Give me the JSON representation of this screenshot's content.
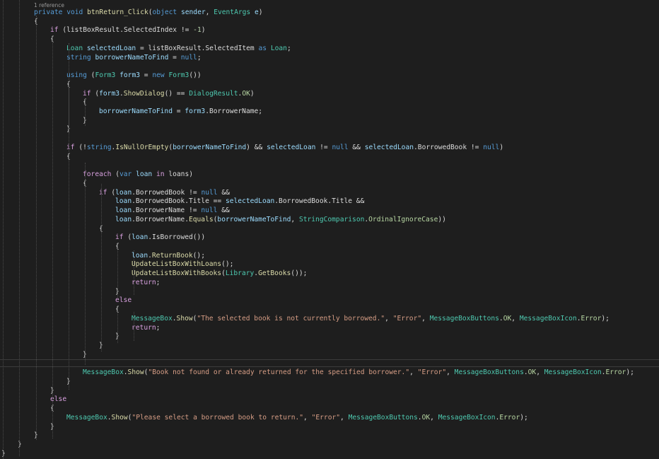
{
  "codelens": "1 reference",
  "lines": [
    {
      "indent": 0,
      "tokens": [
        [
          "kw",
          "private"
        ],
        [
          "pl",
          " "
        ],
        [
          "kw",
          "void"
        ],
        [
          "pl",
          " "
        ],
        [
          "fn",
          "btnReturn_Click"
        ],
        [
          "pl",
          "("
        ],
        [
          "kw",
          "object"
        ],
        [
          "pl",
          " "
        ],
        [
          "loc",
          "sender"
        ],
        [
          "pl",
          ", "
        ],
        [
          "ty",
          "EventArgs"
        ],
        [
          "pl",
          " "
        ],
        [
          "loc",
          "e"
        ],
        [
          "pl",
          ")"
        ]
      ]
    },
    {
      "indent": 0,
      "tokens": [
        [
          "pl",
          "{"
        ]
      ]
    },
    {
      "indent": 1,
      "tokens": [
        [
          "ctl",
          "if"
        ],
        [
          "pl",
          " (listBoxResult.SelectedIndex != "
        ],
        [
          "num",
          "-1"
        ],
        [
          "pl",
          ")"
        ]
      ]
    },
    {
      "indent": 1,
      "tokens": [
        [
          "pl",
          "{"
        ]
      ]
    },
    {
      "indent": 2,
      "tokens": [
        [
          "ty",
          "Loan"
        ],
        [
          "pl",
          " "
        ],
        [
          "loc",
          "selectedLoan"
        ],
        [
          "pl",
          " = listBoxResult.SelectedItem "
        ],
        [
          "kw",
          "as"
        ],
        [
          "pl",
          " "
        ],
        [
          "ty",
          "Loan"
        ],
        [
          "pl",
          ";"
        ]
      ]
    },
    {
      "indent": 2,
      "tokens": [
        [
          "kw",
          "string"
        ],
        [
          "pl",
          " "
        ],
        [
          "loc",
          "borrowerNameToFind"
        ],
        [
          "pl",
          " = "
        ],
        [
          "kw",
          "null"
        ],
        [
          "pl",
          ";"
        ]
      ]
    },
    {
      "indent": 2,
      "tokens": []
    },
    {
      "indent": 2,
      "tokens": [
        [
          "kw",
          "using"
        ],
        [
          "pl",
          " ("
        ],
        [
          "ty",
          "Form3"
        ],
        [
          "pl",
          " "
        ],
        [
          "loc",
          "form3"
        ],
        [
          "pl",
          " = "
        ],
        [
          "kw",
          "new"
        ],
        [
          "pl",
          " "
        ],
        [
          "ty",
          "Form3"
        ],
        [
          "pl",
          "())"
        ]
      ]
    },
    {
      "indent": 2,
      "tokens": [
        [
          "pl",
          "{"
        ]
      ]
    },
    {
      "indent": 3,
      "tokens": [
        [
          "ctl",
          "if"
        ],
        [
          "pl",
          " ("
        ],
        [
          "loc",
          "form3"
        ],
        [
          "pl",
          "."
        ],
        [
          "fn",
          "ShowDialog"
        ],
        [
          "pl",
          "() == "
        ],
        [
          "ty",
          "DialogResult"
        ],
        [
          "pl",
          "."
        ],
        [
          "en",
          "OK"
        ],
        [
          "pl",
          ")"
        ]
      ]
    },
    {
      "indent": 3,
      "tokens": [
        [
          "pl",
          "{"
        ]
      ]
    },
    {
      "indent": 4,
      "tokens": [
        [
          "loc",
          "borrowerNameToFind"
        ],
        [
          "pl",
          " = "
        ],
        [
          "loc",
          "form3"
        ],
        [
          "pl",
          ".BorrowerName;"
        ]
      ]
    },
    {
      "indent": 3,
      "tokens": [
        [
          "pl",
          "}"
        ]
      ]
    },
    {
      "indent": 2,
      "tokens": [
        [
          "pl",
          "}"
        ]
      ]
    },
    {
      "indent": 2,
      "tokens": []
    },
    {
      "indent": 2,
      "tokens": [
        [
          "ctl",
          "if"
        ],
        [
          "pl",
          " (!"
        ],
        [
          "kw",
          "string"
        ],
        [
          "pl",
          "."
        ],
        [
          "fn",
          "IsNullOrEmpty"
        ],
        [
          "pl",
          "("
        ],
        [
          "loc",
          "borrowerNameToFind"
        ],
        [
          "pl",
          ") && "
        ],
        [
          "loc",
          "selectedLoan"
        ],
        [
          "pl",
          " != "
        ],
        [
          "kw",
          "null"
        ],
        [
          "pl",
          " && "
        ],
        [
          "loc",
          "selectedLoan"
        ],
        [
          "pl",
          ".BorrowedBook != "
        ],
        [
          "kw",
          "null"
        ],
        [
          "pl",
          ")"
        ]
      ]
    },
    {
      "indent": 2,
      "tokens": [
        [
          "pl",
          "{"
        ]
      ]
    },
    {
      "indent": 3,
      "tokens": []
    },
    {
      "indent": 3,
      "tokens": [
        [
          "ctl",
          "foreach"
        ],
        [
          "pl",
          " ("
        ],
        [
          "kw",
          "var"
        ],
        [
          "pl",
          " "
        ],
        [
          "loc",
          "loan"
        ],
        [
          "pl",
          " "
        ],
        [
          "ctl",
          "in"
        ],
        [
          "pl",
          " loans)"
        ]
      ]
    },
    {
      "indent": 3,
      "tokens": [
        [
          "pl",
          "{"
        ]
      ]
    },
    {
      "indent": 4,
      "tokens": [
        [
          "ctl",
          "if"
        ],
        [
          "pl",
          " ("
        ],
        [
          "loc",
          "loan"
        ],
        [
          "pl",
          ".BorrowedBook != "
        ],
        [
          "kw",
          "null"
        ],
        [
          "pl",
          " &&"
        ]
      ]
    },
    {
      "indent": 5,
      "tokens": [
        [
          "loc",
          "loan"
        ],
        [
          "pl",
          ".BorrowedBook.Title == "
        ],
        [
          "loc",
          "selectedLoan"
        ],
        [
          "pl",
          ".BorrowedBook.Title &&"
        ]
      ]
    },
    {
      "indent": 5,
      "tokens": [
        [
          "loc",
          "loan"
        ],
        [
          "pl",
          ".BorrowerName != "
        ],
        [
          "kw",
          "null"
        ],
        [
          "pl",
          " &&"
        ]
      ]
    },
    {
      "indent": 5,
      "tokens": [
        [
          "loc",
          "loan"
        ],
        [
          "pl",
          ".BorrowerName."
        ],
        [
          "fn",
          "Equals"
        ],
        [
          "pl",
          "("
        ],
        [
          "loc",
          "borrowerNameToFind"
        ],
        [
          "pl",
          ", "
        ],
        [
          "ty",
          "StringComparison"
        ],
        [
          "pl",
          "."
        ],
        [
          "en",
          "OrdinalIgnoreCase"
        ],
        [
          "pl",
          "))"
        ]
      ]
    },
    {
      "indent": 4,
      "tokens": [
        [
          "pl",
          "{"
        ]
      ]
    },
    {
      "indent": 5,
      "tokens": [
        [
          "ctl",
          "if"
        ],
        [
          "pl",
          " ("
        ],
        [
          "loc",
          "loan"
        ],
        [
          "pl",
          ".IsBorrowed())"
        ]
      ]
    },
    {
      "indent": 5,
      "tokens": [
        [
          "pl",
          "{"
        ]
      ]
    },
    {
      "indent": 6,
      "tokens": [
        [
          "loc",
          "loan"
        ],
        [
          "pl",
          "."
        ],
        [
          "fn",
          "ReturnBook"
        ],
        [
          "pl",
          "();"
        ]
      ]
    },
    {
      "indent": 6,
      "tokens": [
        [
          "fn",
          "UpdateListBoxWithLoans"
        ],
        [
          "pl",
          "();"
        ]
      ]
    },
    {
      "indent": 6,
      "tokens": [
        [
          "fn",
          "UpdateListBoxWithBooks"
        ],
        [
          "pl",
          "("
        ],
        [
          "ty",
          "Library"
        ],
        [
          "pl",
          "."
        ],
        [
          "fn",
          "GetBooks"
        ],
        [
          "pl",
          "());"
        ]
      ]
    },
    {
      "indent": 6,
      "tokens": [
        [
          "ctl",
          "return"
        ],
        [
          "pl",
          ";"
        ]
      ]
    },
    {
      "indent": 5,
      "tokens": [
        [
          "pl",
          "}"
        ]
      ]
    },
    {
      "indent": 5,
      "tokens": [
        [
          "ctl",
          "else"
        ]
      ]
    },
    {
      "indent": 5,
      "tokens": [
        [
          "pl",
          "{"
        ]
      ]
    },
    {
      "indent": 6,
      "tokens": [
        [
          "ty",
          "MessageBox"
        ],
        [
          "pl",
          "."
        ],
        [
          "fn",
          "Show"
        ],
        [
          "pl",
          "("
        ],
        [
          "str",
          "\"The selected book is not currently borrowed.\""
        ],
        [
          "pl",
          ", "
        ],
        [
          "str",
          "\"Error\""
        ],
        [
          "pl",
          ", "
        ],
        [
          "ty",
          "MessageBoxButtons"
        ],
        [
          "pl",
          "."
        ],
        [
          "en",
          "OK"
        ],
        [
          "pl",
          ", "
        ],
        [
          "ty",
          "MessageBoxIcon"
        ],
        [
          "pl",
          "."
        ],
        [
          "en",
          "Error"
        ],
        [
          "pl",
          ");"
        ]
      ]
    },
    {
      "indent": 6,
      "tokens": [
        [
          "ctl",
          "return"
        ],
        [
          "pl",
          ";"
        ]
      ]
    },
    {
      "indent": 5,
      "tokens": [
        [
          "pl",
          "}"
        ]
      ]
    },
    {
      "indent": 4,
      "tokens": [
        [
          "pl",
          "}"
        ]
      ]
    },
    {
      "indent": 3,
      "tokens": [
        [
          "pl",
          "}"
        ]
      ]
    },
    {
      "indent": 3,
      "tokens": [],
      "separator": true
    },
    {
      "indent": 3,
      "tokens": [
        [
          "ty",
          "MessageBox"
        ],
        [
          "pl",
          "."
        ],
        [
          "fn",
          "Show"
        ],
        [
          "pl",
          "("
        ],
        [
          "str",
          "\"Book not found or already returned for the specified borrower.\""
        ],
        [
          "pl",
          ", "
        ],
        [
          "str",
          "\"Error\""
        ],
        [
          "pl",
          ", "
        ],
        [
          "ty",
          "MessageBoxButtons"
        ],
        [
          "pl",
          "."
        ],
        [
          "en",
          "OK"
        ],
        [
          "pl",
          ", "
        ],
        [
          "ty",
          "MessageBoxIcon"
        ],
        [
          "pl",
          "."
        ],
        [
          "en",
          "Error"
        ],
        [
          "pl",
          ");"
        ]
      ]
    },
    {
      "indent": 2,
      "tokens": [
        [
          "pl",
          "}"
        ]
      ]
    },
    {
      "indent": 1,
      "tokens": [
        [
          "pl",
          "}"
        ]
      ]
    },
    {
      "indent": 1,
      "tokens": [
        [
          "ctl",
          "else"
        ]
      ]
    },
    {
      "indent": 1,
      "tokens": [
        [
          "pl",
          "{"
        ]
      ]
    },
    {
      "indent": 2,
      "tokens": [
        [
          "ty",
          "MessageBox"
        ],
        [
          "pl",
          "."
        ],
        [
          "fn",
          "Show"
        ],
        [
          "pl",
          "("
        ],
        [
          "str",
          "\"Please select a borrowed book to return.\""
        ],
        [
          "pl",
          ", "
        ],
        [
          "str",
          "\"Error\""
        ],
        [
          "pl",
          ", "
        ],
        [
          "ty",
          "MessageBoxButtons"
        ],
        [
          "pl",
          "."
        ],
        [
          "en",
          "OK"
        ],
        [
          "pl",
          ", "
        ],
        [
          "ty",
          "MessageBoxIcon"
        ],
        [
          "pl",
          "."
        ],
        [
          "en",
          "Error"
        ],
        [
          "pl",
          ");"
        ]
      ]
    },
    {
      "indent": 1,
      "tokens": [
        [
          "pl",
          "}"
        ]
      ]
    },
    {
      "indent": 0,
      "tokens": [
        [
          "pl",
          "}"
        ]
      ]
    },
    {
      "indent": -1,
      "tokens": [
        [
          "pl",
          "}"
        ]
      ]
    },
    {
      "indent": -2,
      "tokens": [
        [
          "pl",
          "}"
        ]
      ]
    }
  ]
}
